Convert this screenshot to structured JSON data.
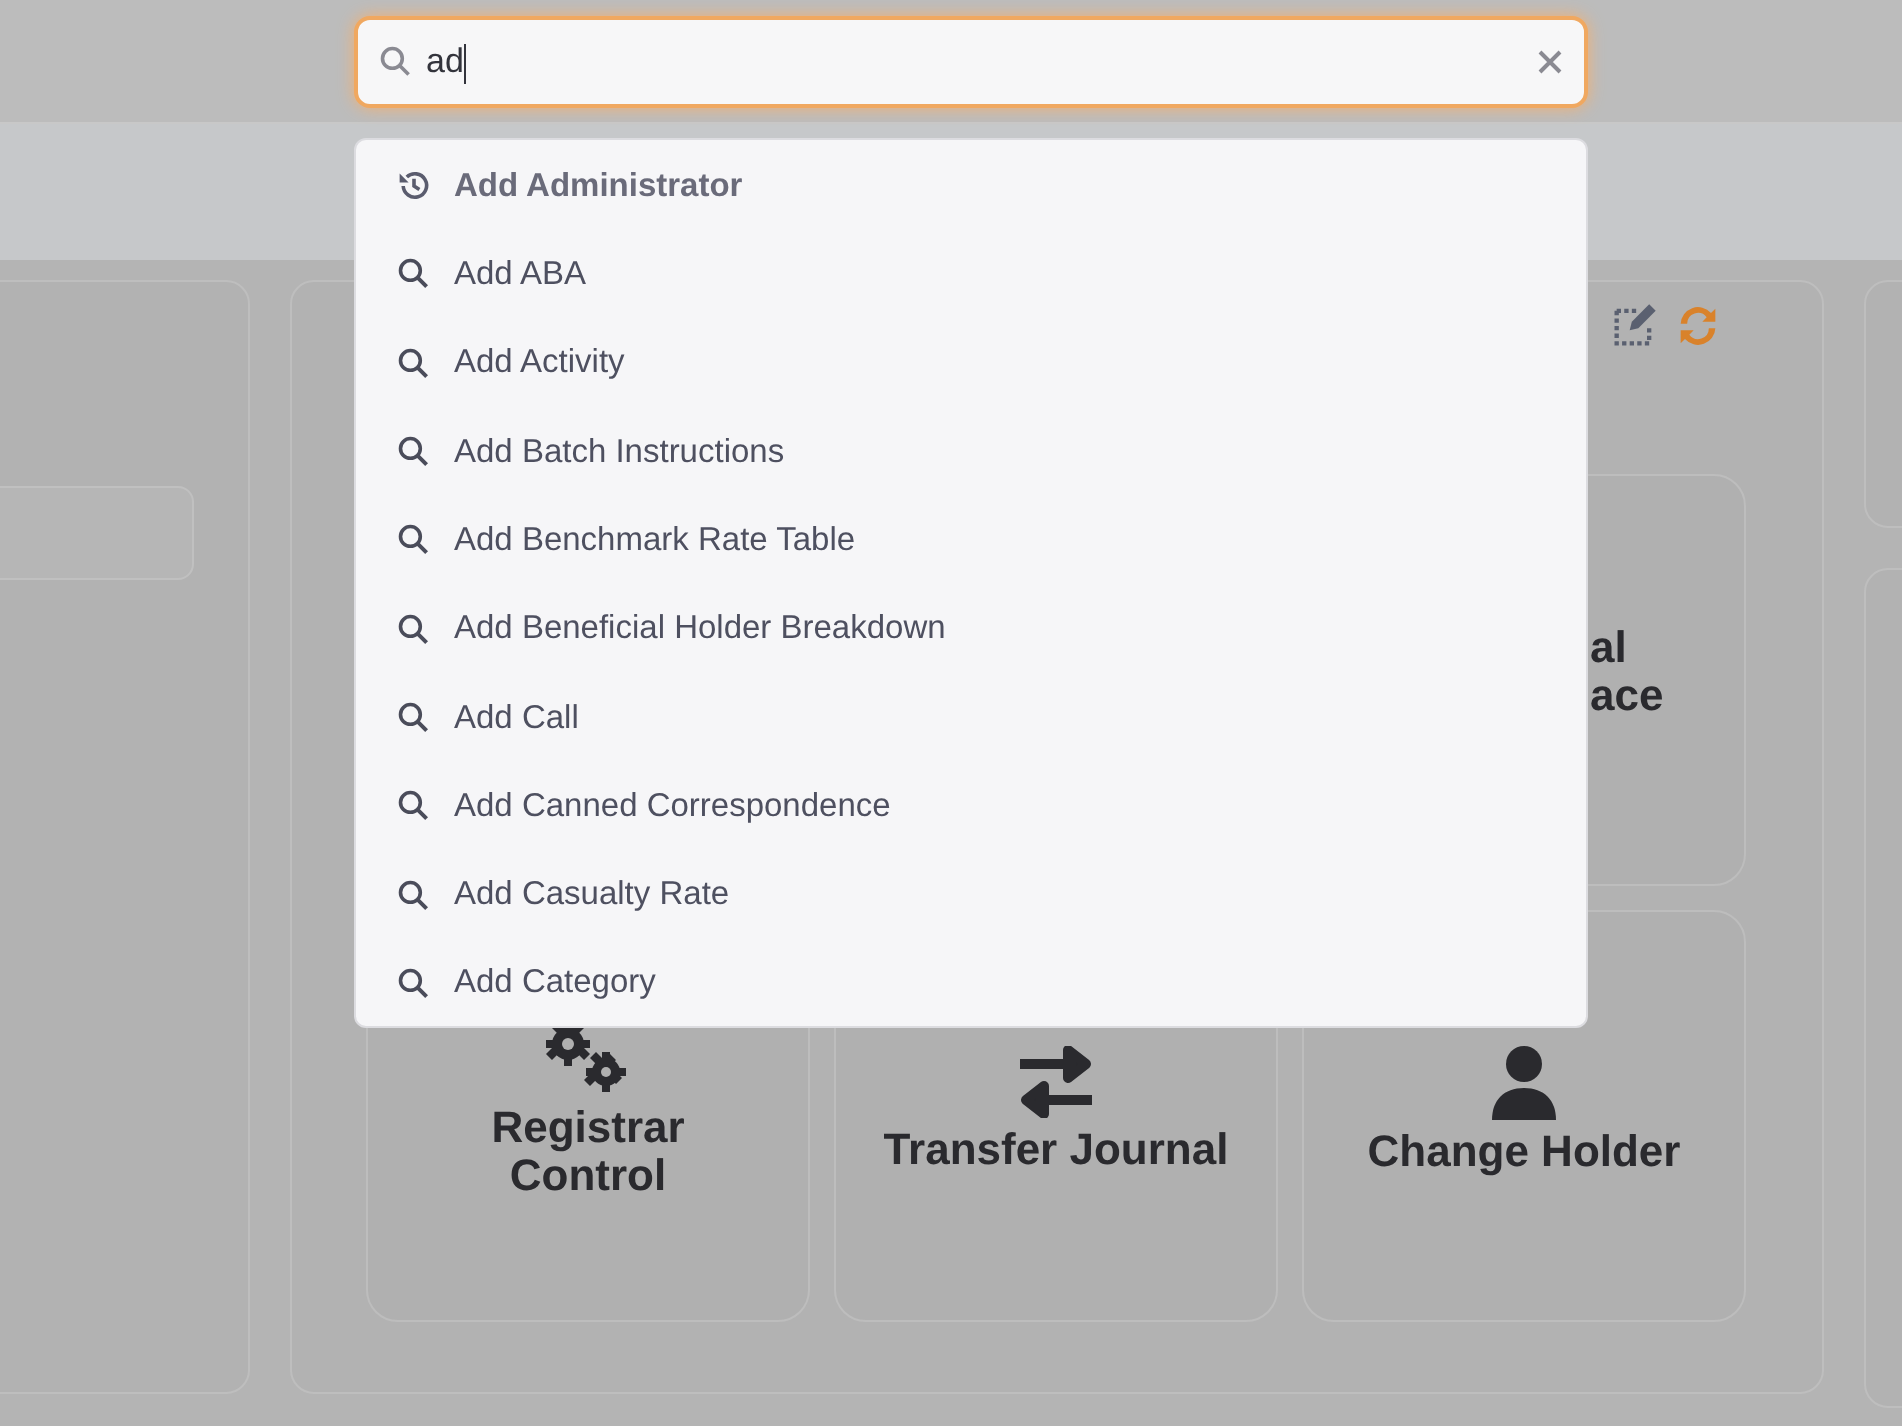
{
  "search": {
    "value": "ad",
    "focused": true
  },
  "suggestions": [
    {
      "label": "Add Administrator",
      "kind": "recent"
    },
    {
      "label": "Add ABA",
      "kind": "search"
    },
    {
      "label": "Add Activity",
      "kind": "search"
    },
    {
      "label": "Add Batch Instructions",
      "kind": "search"
    },
    {
      "label": "Add Benchmark Rate Table",
      "kind": "search"
    },
    {
      "label": "Add Beneficial Holder Breakdown",
      "kind": "search"
    },
    {
      "label": "Add Call",
      "kind": "search"
    },
    {
      "label": "Add Canned Correspondence",
      "kind": "search"
    },
    {
      "label": "Add Casualty Rate",
      "kind": "search"
    },
    {
      "label": "Add Category",
      "kind": "search"
    }
  ],
  "tiles": [
    {
      "lines": [
        "al",
        "ace"
      ],
      "kind": "partial"
    },
    {
      "lines": [
        "Registrar",
        "Control"
      ],
      "kind": "gears"
    },
    {
      "lines": [
        "Transfer Journal"
      ],
      "kind": "transfer"
    },
    {
      "lines": [
        "Change Holder"
      ],
      "kind": "person"
    }
  ]
}
